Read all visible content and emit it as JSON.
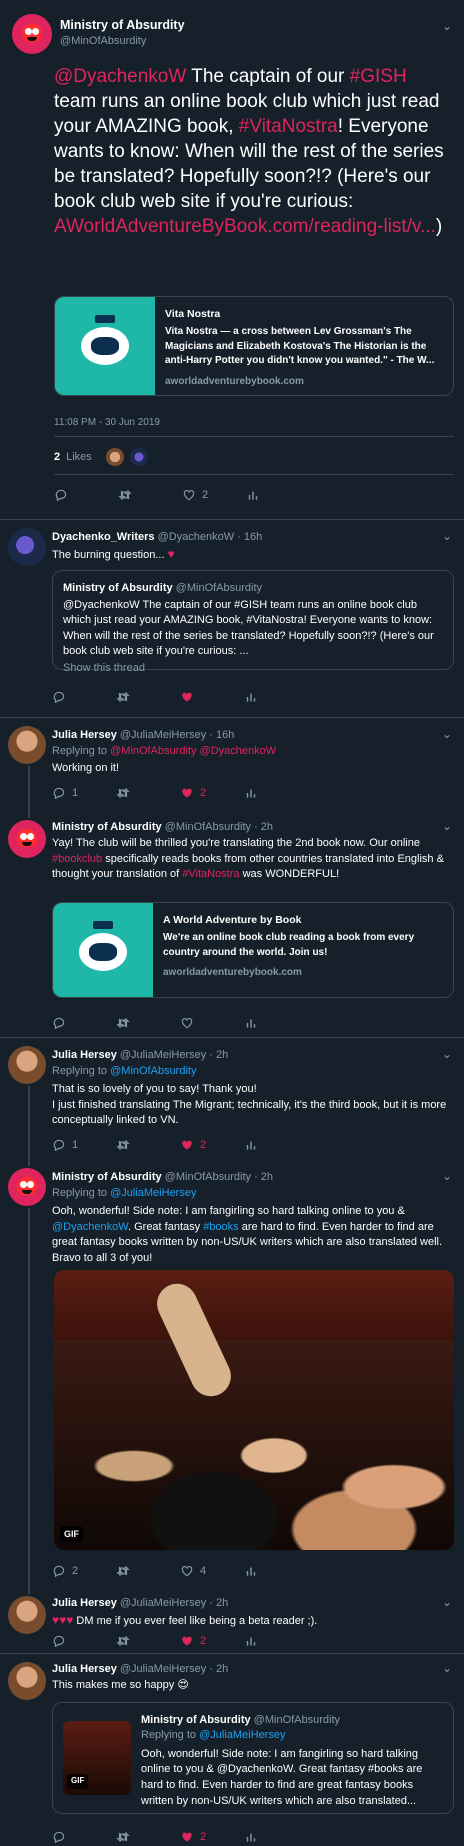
{
  "main_tweet": {
    "name": "Ministry of Absurdity",
    "handle": "@MinOfAbsurdity",
    "text_parts": {
      "p1": "@DyachenkoW",
      "p2": " The captain of our ",
      "p3": "#GISH",
      "p4": " team runs an online book club which just read your AMAZING book, ",
      "p5": "#VitaNostra",
      "p6": "! Everyone wants to know: When will the rest of the series be translated? Hopefully soon?!? (Here's our book club web site if you're curious: ",
      "p7": "AWorldAdventureByBook.com/reading-list/v...",
      "p8": ")"
    },
    "card": {
      "title": "Vita Nostra",
      "desc": "Vita Nostra — a cross between Lev Grossman's The Magicians and Elizabeth Kostova's The Historian is the anti-Harry Potter you didn't know you wanted.\" - The W...",
      "url": "aworldadventurebybook.com"
    },
    "timestamp": "11:08 PM - 30 Jun 2019",
    "likes_count": "2",
    "likes_label": "Likes",
    "like_action_count": "2"
  },
  "tweet2": {
    "name": "Dyachenko_Writers",
    "handle": "@DyachenkoW · 16h",
    "text": "The burning question...",
    "heart": "♥",
    "quote": {
      "name": "Ministry of Absurdity",
      "handle": "@MinOfAbsurdity",
      "text": "@DyachenkoW The captain of our #GISH team runs an online book club which just read your AMAZING book, #VitaNostra! Everyone wants to know: When will the rest of the series be translated? Hopefully soon?!? (Here's our book club web site if you're curious: ...",
      "show_thread": "Show this thread"
    }
  },
  "tweet3": {
    "name": "Julia Hersey",
    "handle": "@JuliaMeiHersey · 16h",
    "replying_label": "Replying to",
    "replying_to": "@MinOfAbsurdity @DyachenkoW",
    "text": "Working on it!",
    "reply_count": "1",
    "like_count": "2"
  },
  "tweet4": {
    "name": "Ministry of Absurdity",
    "handle": "@MinOfAbsurdity · 2h",
    "t1": "Yay! The club will be thrilled you're translating the 2nd book now. Our online ",
    "t2": "#bookclub",
    "t3": " specifically reads books from other countries translated into English & thought your translation of ",
    "t4": "#VitaNostra",
    "t5": " was WONDERFUL!",
    "card": {
      "title": "A World Adventure by Book",
      "desc": "We're an online book club reading a book from every country around the world. Join us!",
      "url": "aworldadventurebybook.com"
    }
  },
  "tweet5": {
    "name": "Julia Hersey",
    "handle": "@JuliaMeiHersey · 2h",
    "replying_label": "Replying to",
    "replying_to": "@MinOfAbsurdity",
    "line1": "That is so lovely of you to say! Thank you!",
    "line2": "I just finished translating The Migrant; technically, it's the third book, but it is more conceptually linked to VN.",
    "reply_count": "1",
    "like_count": "2"
  },
  "tweet6": {
    "name": "Ministry of Absurdity",
    "handle": "@MinOfAbsurdity · 2h",
    "replying_label": "Replying to",
    "replying_to": "@JuliaMeiHersey",
    "t1": "Ooh, wonderful! Side note: I am fangirling so hard talking online to you & ",
    "t2": "@DyachenkoW",
    "t3": ".  Great fantasy ",
    "t4": "#books",
    "t5": " are hard to find. Even harder to find are great fantasy books written by non-US/UK writers which are also translated well. Bravo to all 3 of you!",
    "gif_label": "GIF",
    "reply_count": "2",
    "like_count": "4"
  },
  "tweet7": {
    "name": "Julia Hersey",
    "handle": "@JuliaMeiHersey · 2h",
    "hearts": "♥♥♥",
    "text": " DM me if you ever feel like being a beta reader ;).",
    "like_count": "2"
  },
  "tweet8": {
    "name": "Julia Hersey",
    "handle": "@JuliaMeiHersey · 2h",
    "text": "This makes me so happy",
    "emoji": "😍",
    "quote": {
      "name": "Ministry of Absurdity",
      "handle": "@MinOfAbsurdity",
      "replying_label": "Replying to",
      "replying_to": "@JuliaMeiHersey",
      "text": "Ooh, wonderful! Side note: I am fangirling so hard talking online to you & @DyachenkoW.  Great fantasy #books are hard to find. Even harder to find are great fantasy books written by non-US/UK writers which are also translated...",
      "gif_label": "GIF"
    },
    "like_count": "2"
  },
  "colors": {
    "background": "#15202b",
    "accent": "#e0245e",
    "link_blue": "#1da1f2",
    "muted": "#8899a6",
    "border": "#38444d"
  },
  "icons": [
    "reply-icon",
    "retweet-icon",
    "like-icon",
    "analytics-icon",
    "more-icon"
  ]
}
